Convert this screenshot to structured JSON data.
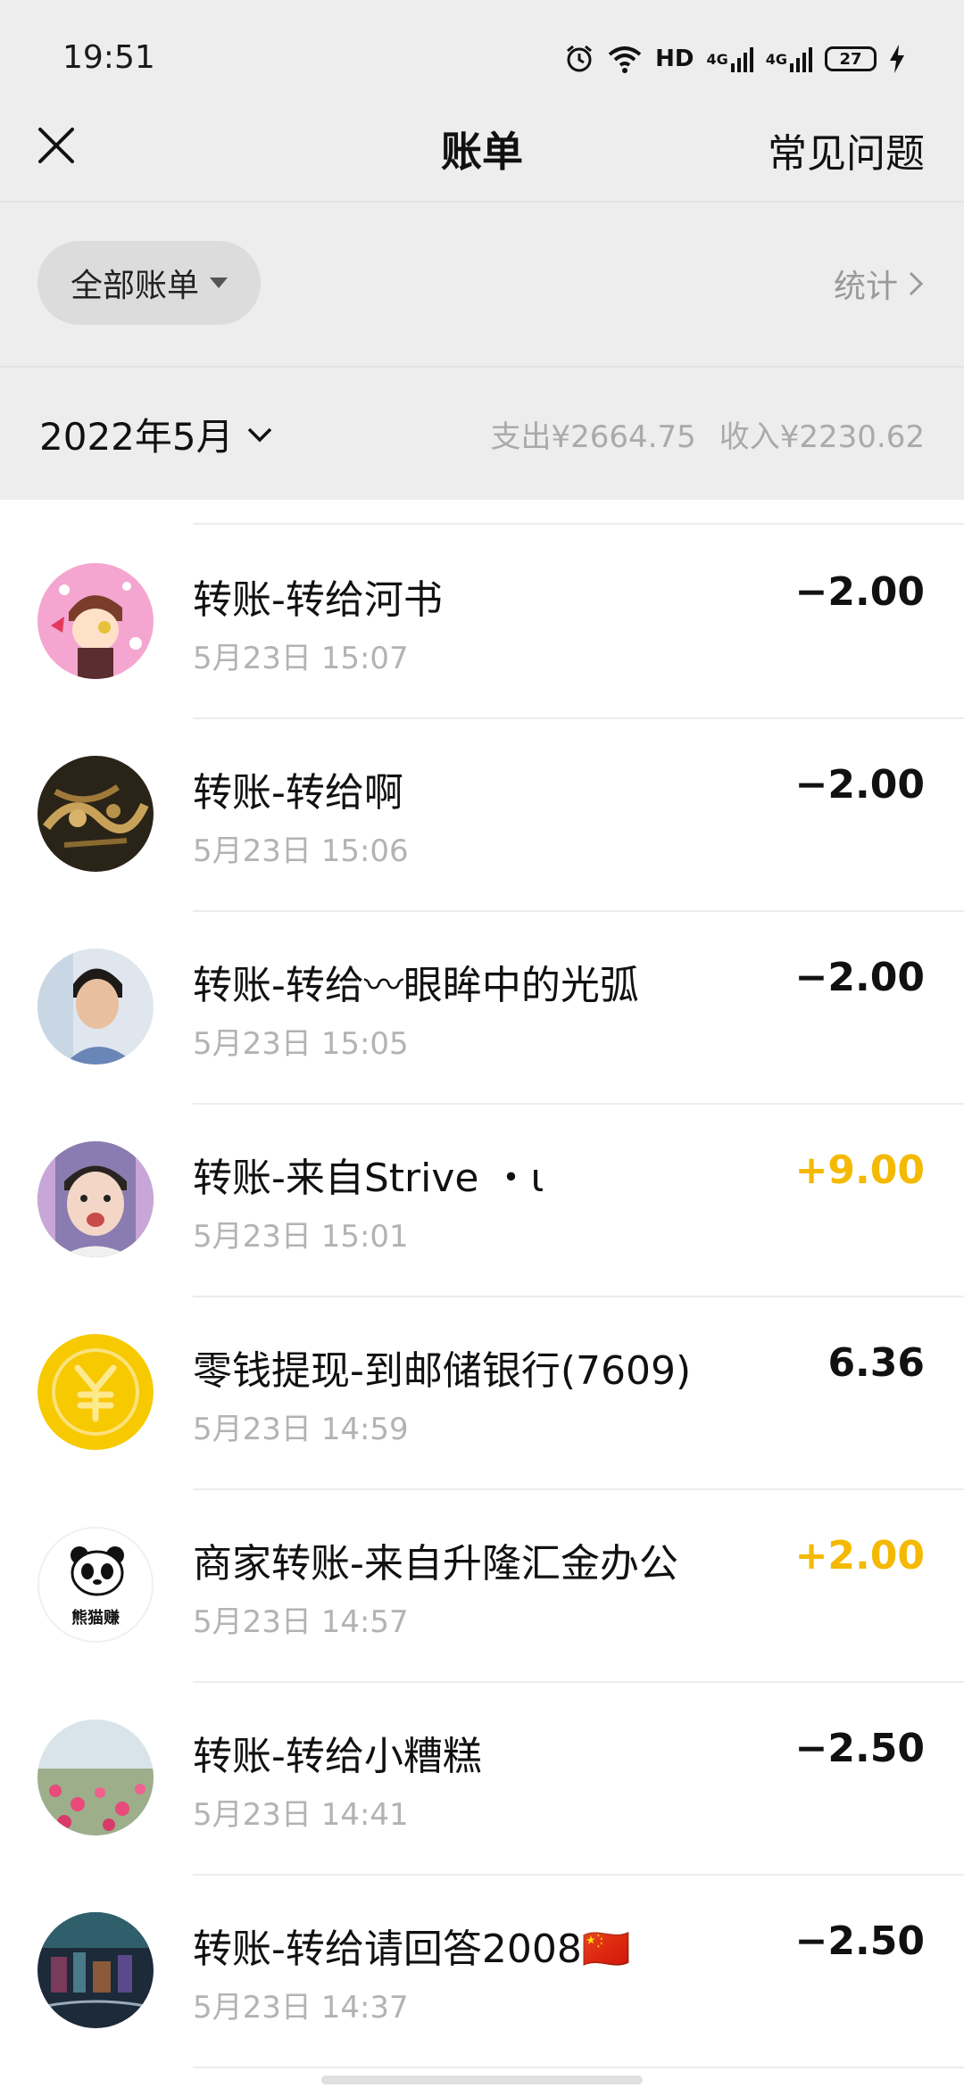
{
  "status_bar": {
    "time": "19:51",
    "network_labels": [
      "HD",
      "4G",
      "4G"
    ],
    "battery": "27"
  },
  "header": {
    "title": "账单",
    "faq": "常见问题"
  },
  "filter": {
    "label": "全部账单",
    "stats": "统计"
  },
  "month_bar": {
    "month": "2022年5月",
    "expense": "支出¥2664.75",
    "income": "收入¥2230.62"
  },
  "colors": {
    "income": "#f4b900",
    "expense": "#111111",
    "coin": "#f6c900"
  },
  "transactions": [
    {
      "title": "转账-转给河书",
      "time": "5月23日 15:07",
      "amount": "−2.00",
      "type": "expense",
      "avatar": "cartoon-avatar"
    },
    {
      "title": "转账-转给啊",
      "time": "5月23日 15:06",
      "amount": "−2.00",
      "type": "expense",
      "avatar": "dark-photo-avatar"
    },
    {
      "title": "转账-转给〰眼眸中的光弧",
      "time": "5月23日 15:05",
      "amount": "−2.00",
      "type": "expense",
      "avatar": "person-photo-avatar"
    },
    {
      "title": "转账-来自Strive ・ι",
      "time": "5月23日 15:01",
      "amount": "+9.00",
      "type": "income",
      "avatar": "child-photo-avatar"
    },
    {
      "title": "零钱提现-到邮储银行(7609)",
      "time": "5月23日 14:59",
      "amount": "6.36",
      "type": "neutral",
      "avatar": "yuan-coin-icon"
    },
    {
      "title": "商家转账-来自升隆汇金办公",
      "time": "5月23日 14:57",
      "amount": "+2.00",
      "type": "income",
      "avatar": "panda-logo",
      "logo_text": "熊猫赚"
    },
    {
      "title": "转账-转给小糟糕",
      "time": "5月23日 14:41",
      "amount": "−2.50",
      "type": "expense",
      "avatar": "flowers-photo-avatar"
    },
    {
      "title": "转账-转给请回答2008🇨🇳",
      "time": "5月23日 14:37",
      "amount": "−2.50",
      "type": "expense",
      "avatar": "city-photo-avatar"
    }
  ]
}
